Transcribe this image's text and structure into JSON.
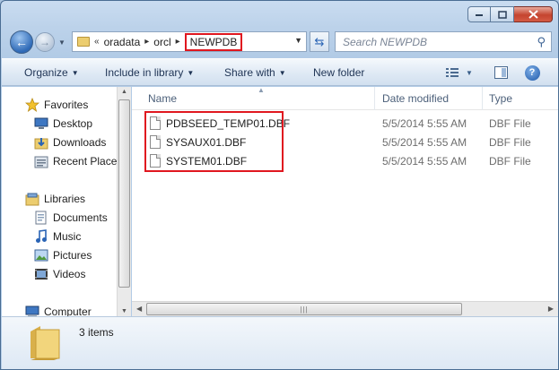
{
  "window": {
    "caption_buttons": [
      "minimize",
      "maximize",
      "close"
    ]
  },
  "address": {
    "overflow": "«",
    "crumbs": [
      "oradata",
      "orcl",
      "NEWPDB"
    ],
    "separator": "▸"
  },
  "search": {
    "placeholder": "Search NEWPDB"
  },
  "toolbar": {
    "organize": "Organize",
    "include_in_library": "Include in library",
    "share_with": "Share with",
    "new_folder": "New folder"
  },
  "nav": {
    "favorites": "Favorites",
    "desktop": "Desktop",
    "downloads": "Downloads",
    "recent_places": "Recent Place",
    "libraries": "Libraries",
    "documents": "Documents",
    "music": "Music",
    "pictures": "Pictures",
    "videos": "Videos",
    "computer": "Computer"
  },
  "columns": {
    "name": "Name",
    "date_modified": "Date modified",
    "type": "Type"
  },
  "files": [
    {
      "name": "PDBSEED_TEMP01.DBF",
      "date": "5/5/2014 5:55 AM",
      "type": "DBF File"
    },
    {
      "name": "SYSAUX01.DBF",
      "date": "5/5/2014 5:55 AM",
      "type": "DBF File"
    },
    {
      "name": "SYSTEM01.DBF",
      "date": "5/5/2014 5:55 AM",
      "type": "DBF File"
    }
  ],
  "details": {
    "item_count": "3 items"
  },
  "colors": {
    "highlight": "#e0171f",
    "accent": "#2f6ab7"
  }
}
